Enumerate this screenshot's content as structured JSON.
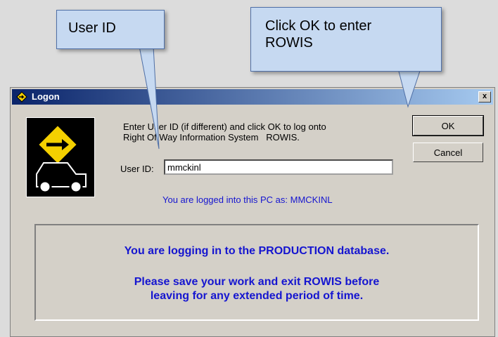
{
  "window": {
    "title": "Logon",
    "close_label": "x",
    "prompt_line1": "Enter User ID (if different) and click OK to log onto",
    "prompt_line2": "Right Of Way Information System   ROWIS.",
    "userid_label": "User ID:",
    "userid_value": "mmckinl",
    "ok_label": "OK",
    "cancel_label": "Cancel",
    "pc_login_text": "You are logged into this PC as: MMCKINL",
    "notice_line1": "You are logging in to the PRODUCTION database.",
    "notice_line2": "Please save your work and exit ROWIS before",
    "notice_line3": "leaving for any extended period of time."
  },
  "callouts": {
    "userid_text": "User ID",
    "ok_line1": "Click OK to enter",
    "ok_line2": "ROWIS"
  }
}
